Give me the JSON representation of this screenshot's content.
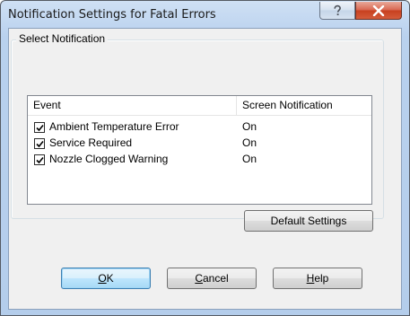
{
  "window": {
    "title": "Notification Settings for Fatal Errors",
    "help_icon": "question-mark-icon",
    "close_icon": "close-x-icon"
  },
  "group": {
    "label": "Select Notification"
  },
  "list": {
    "columns": [
      "Event",
      "Screen Notification"
    ],
    "rows": [
      {
        "checked": true,
        "event": "Ambient Temperature Error",
        "screen": "On"
      },
      {
        "checked": true,
        "event": "Service Required",
        "screen": "On"
      },
      {
        "checked": true,
        "event": "Nozzle Clogged Warning",
        "screen": "On"
      }
    ]
  },
  "buttons": {
    "default_settings": "Default Settings",
    "ok": {
      "mnemonic": "O",
      "rest": "K"
    },
    "cancel": {
      "mnemonic": "C",
      "rest": "ancel"
    },
    "help": {
      "mnemonic": "H",
      "rest": "elp"
    }
  },
  "colors": {
    "title_bar": "#b9d1ee",
    "close_button": "#c7401f",
    "ok_button_border": "#3c7fb1"
  }
}
